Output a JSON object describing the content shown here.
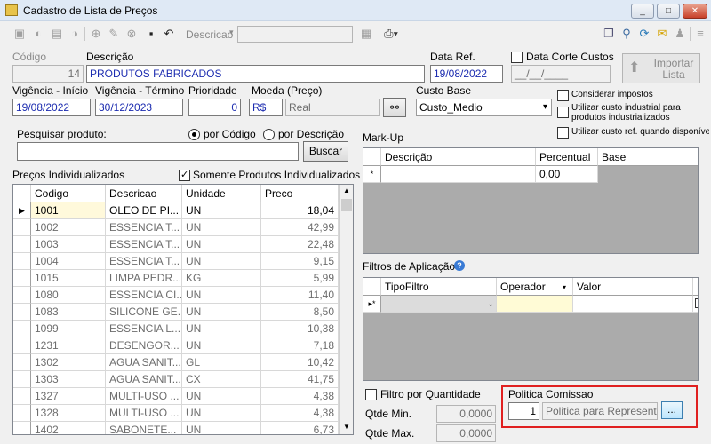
{
  "window": {
    "title": "Cadastro de Lista de Preços",
    "minimize": "_",
    "maximize": "□",
    "close": "✕"
  },
  "toolbar": {
    "filter_label": "Descricao",
    "filter_value": ""
  },
  "form": {
    "codigo_label": "Código",
    "codigo_value": "14",
    "descricao_label": "Descrição",
    "descricao_value": "PRODUTOS FABRICADOS",
    "dataref_label": "Data Ref.",
    "dataref_value": "19/08/2022",
    "datacorte_label": "Data Corte Custos",
    "datacorte_value": "__/__/____",
    "importar_label": "Importar Lista",
    "vig_inicio_label": "Vigência - Início",
    "vig_inicio_value": "19/08/2022",
    "vig_termino_label": "Vigência - Término",
    "vig_termino_value": "30/12/2023",
    "prioridade_label": "Prioridade",
    "prioridade_value": "0",
    "moeda_label": "Moeda (Preço)",
    "moeda_code": "R$",
    "moeda_name": "Real",
    "custobase_label": "Custo Base",
    "custobase_value": "Custo_Medio",
    "opt_impostos": "Considerar impostos",
    "opt_custo_industrial": "Utilizar custo industrial para produtos industrializados",
    "opt_custo_ref": "Utilizar custo ref. quando disponível"
  },
  "search": {
    "label": "Pesquisar produto:",
    "radio_codigo": "por Código",
    "radio_descricao": "por Descrição",
    "value": "",
    "button": "Buscar"
  },
  "precos": {
    "title": "Preços Individualizados",
    "somente_label": "Somente Produtos Individualizados",
    "columns": [
      "Codigo",
      "Descricao",
      "Unidade",
      "Preco"
    ],
    "rows": [
      {
        "codigo": "1001",
        "descricao": "OLEO DE PI...",
        "unidade": "UN",
        "preco": "18,04"
      },
      {
        "codigo": "1002",
        "descricao": "ESSENCIA T...",
        "unidade": "UN",
        "preco": "42,99"
      },
      {
        "codigo": "1003",
        "descricao": "ESSENCIA T...",
        "unidade": "UN",
        "preco": "22,48"
      },
      {
        "codigo": "1004",
        "descricao": "ESSENCIA T...",
        "unidade": "UN",
        "preco": "9,15"
      },
      {
        "codigo": "1015",
        "descricao": "LIMPA PEDR...",
        "unidade": "KG",
        "preco": "5,99"
      },
      {
        "codigo": "1080",
        "descricao": "ESSENCIA CI...",
        "unidade": "UN",
        "preco": "11,40"
      },
      {
        "codigo": "1083",
        "descricao": "SILICONE GE...",
        "unidade": "UN",
        "preco": "8,50"
      },
      {
        "codigo": "1099",
        "descricao": "ESSENCIA L...",
        "unidade": "UN",
        "preco": "10,38"
      },
      {
        "codigo": "1231",
        "descricao": "DESENGOR...",
        "unidade": "UN",
        "preco": "7,18"
      },
      {
        "codigo": "1302",
        "descricao": "AGUA SANIT...",
        "unidade": "GL",
        "preco": "10,42"
      },
      {
        "codigo": "1303",
        "descricao": "AGUA SANIT...",
        "unidade": "CX",
        "preco": "41,75"
      },
      {
        "codigo": "1327",
        "descricao": "MULTI-USO ...",
        "unidade": "UN",
        "preco": "4,38"
      },
      {
        "codigo": "1328",
        "descricao": "MULTI-USO ...",
        "unidade": "UN",
        "preco": "4,38"
      },
      {
        "codigo": "1402",
        "descricao": "SABONETE...",
        "unidade": "UN",
        "preco": "6,73"
      }
    ]
  },
  "markup": {
    "title": "Mark-Up",
    "columns": [
      "Descrição",
      "Percentual",
      "Base"
    ],
    "new_row_percentual": "0,00",
    "new_row_marker": "*"
  },
  "filtros": {
    "title": "Filtros de Aplicação",
    "columns": [
      "TipoFiltro",
      "Operador",
      "Valor",
      "E"
    ],
    "new_row_marker": "▸*"
  },
  "quantidade": {
    "filtro_label": "Filtro por Quantidade",
    "min_label": "Qtde Min.",
    "min_value": "0,0000",
    "max_label": "Qtde Max.",
    "max_value": "0,0000"
  },
  "comissao": {
    "title": "Politica Comissao",
    "code": "1",
    "name": "Politica para Representa",
    "button": "..."
  },
  "colors": {
    "highlight_border": "#e02020",
    "text_blue": "#1c2cb0",
    "selected_cell": "#fff9db",
    "operator_cell": "#fffbd6"
  }
}
